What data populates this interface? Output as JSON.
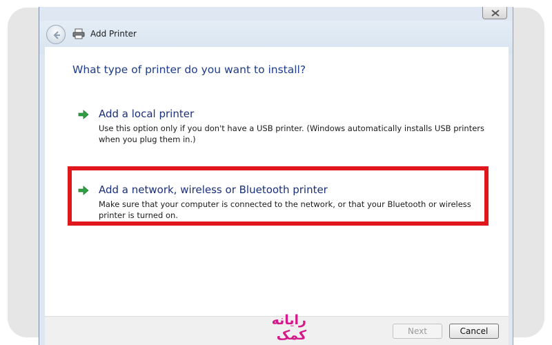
{
  "window": {
    "title": "Add Printer"
  },
  "page": {
    "heading": "What type of printer do you want to install?"
  },
  "options": [
    {
      "title": "Add a local printer",
      "description": "Use this option only if you don't have a USB printer. (Windows automatically installs USB printers when you plug them in.)"
    },
    {
      "title": "Add a network, wireless or Bluetooth printer",
      "description": "Make sure that your computer is connected to the network, or that your Bluetooth or wireless printer is turned on."
    }
  ],
  "footer": {
    "next_label": "Next",
    "cancel_label": "Cancel"
  },
  "watermark": {
    "text": "رایانه کمک"
  },
  "colors": {
    "heading": "#1e3b8c",
    "option_title": "#1a2f7a",
    "arrow": "#2ea043",
    "highlight": "#e0181d",
    "watermark": "#d6198a"
  },
  "icons": {
    "back": "back-arrow-icon",
    "printer": "printer-icon",
    "close": "close-icon",
    "option_arrow": "green-arrow-icon"
  }
}
